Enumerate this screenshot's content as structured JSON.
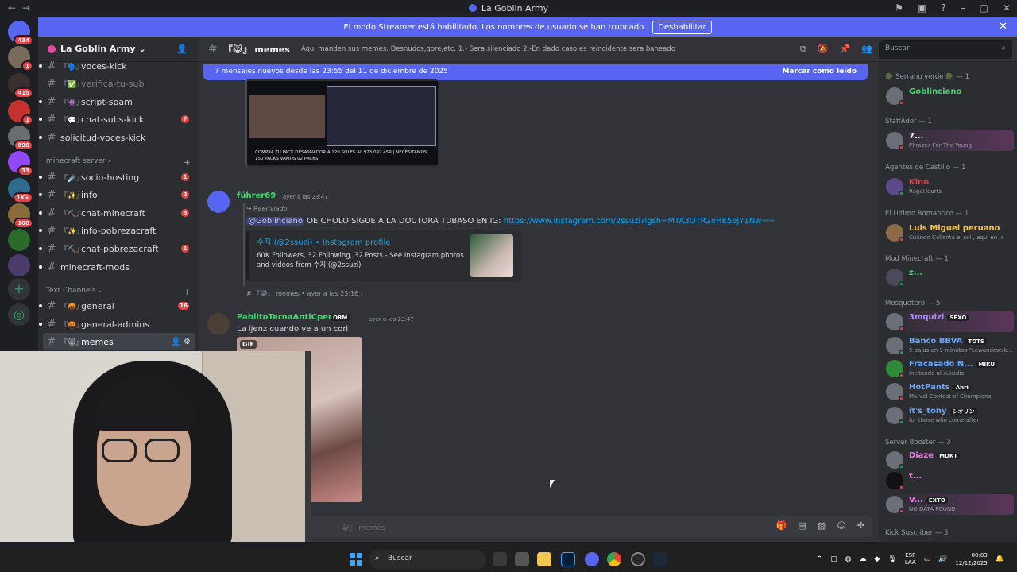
{
  "window": {
    "title": "La Goblin Army"
  },
  "banner": {
    "text": "El modo Streamer está habilitado. Los nombres de usuario se han truncado.",
    "button": "Deshabilitar"
  },
  "servers": {
    "badges": [
      "434",
      "1",
      "415",
      "1",
      "898",
      "33",
      "1K+",
      "100"
    ]
  },
  "sidebar": {
    "guild_name": "La Goblin Army",
    "channels_top": [
      {
        "emoji": "『🗣️』",
        "label": "voces-kick",
        "muted": false,
        "count": ""
      },
      {
        "emoji": "『✅』",
        "label": "verifica-tu-sub",
        "muted": true,
        "count": ""
      },
      {
        "emoji": "『👾』",
        "label": "script-spam",
        "muted": false,
        "count": ""
      },
      {
        "emoji": "『💬』",
        "label": "chat-subs-kick",
        "muted": false,
        "count": "7"
      },
      {
        "emoji": "",
        "label": "solicitud-voces-kick",
        "muted": false,
        "count": ""
      }
    ],
    "category_minecraft": "minecraft server",
    "channels_minecraft": [
      {
        "emoji": "『☄️』",
        "label": "socio-hosting",
        "count": "1"
      },
      {
        "emoji": "『✨』",
        "label": "info",
        "count": "2"
      },
      {
        "emoji": "『⛏️』",
        "label": "chat-minecraft",
        "count": "3"
      },
      {
        "emoji": "『✨』",
        "label": "info-pobrezacraft",
        "count": ""
      },
      {
        "emoji": "『⛏️』",
        "label": "chat-pobrezacraft",
        "count": "1"
      },
      {
        "emoji": "",
        "label": "minecraft-mods",
        "count": ""
      }
    ],
    "category_text": "Text Channels",
    "channels_text": [
      {
        "emoji": "『🤬』",
        "label": "general",
        "count": "16"
      },
      {
        "emoji": "『🤬』",
        "label": "general-admins",
        "count": ""
      },
      {
        "emoji": "『😹』",
        "label": "memes",
        "count": ""
      }
    ]
  },
  "chat_header": {
    "channel": "『😹』 memes",
    "topic": "Aqui manden sus memes. Desnudos,gore,etc. 1.- Sera silenciado 2.-En dado caso es reincidente sera baneado"
  },
  "search": {
    "placeholder": "Buscar"
  },
  "new_messages": {
    "text": "7 mensajes nuevos desde las 23:55 del 11 de diciembre de 2025",
    "action": "Marcar como leído"
  },
  "messages": {
    "promo_text": "COMPRA TU PACK DESASNADOR A 120 SOLES AL 923 097 459 | NECESITAMOS 150 PACKS VAMOS 02 PACKS",
    "m1": {
      "author": "führer69",
      "time": "ayer a las 23:47",
      "forwarded": "Reenviado",
      "mention": "@Goblinciano",
      "text": "OE CHOLO SIGUE A LA DOCTORA TUBASO EN IG:",
      "link": "https://www.instagram.com/2ssuzi?igsh=MTA3OTR2eHE5ejY1Nw==",
      "embed_title": "수지 (@2ssuzi) • Instagram profile",
      "embed_desc": "60K Followers, 32 Following, 32 Posts - See Instagram photos and videos from 수지 (@2ssuzi)",
      "source": "『😹』 memes • ayer a las 23:16"
    },
    "m2": {
      "author": "PablitoTernaAntiCperos",
      "tag": "ORM",
      "time": "ayer a las 23:47",
      "text": "La ijenz cuando ve a un cori",
      "gif_label": "GIF"
    }
  },
  "composer": {
    "placeholder": "『😹』 memes"
  },
  "members": [
    {
      "role": "🪖 Serrano verde 🪖 — 1"
    },
    {
      "name": "Goblinciano",
      "sub": "",
      "color": "#3ed96b"
    },
    {
      "role": "StaffAdor — 1"
    },
    {
      "name": "7...",
      "sub": "Phrazes For The Young",
      "color": "#ffffff"
    },
    {
      "role": "Agentes de Castillo — 1"
    },
    {
      "name": "Kino",
      "sub": "RageHearts",
      "color": "#e23c3c"
    },
    {
      "role": "El Ultimo Romantico — 1"
    },
    {
      "name": "Luis Miguel peruano",
      "sub": "Cuando Calienta el sol , aqui en la",
      "color": "#f5c542"
    },
    {
      "role": "Mod Minecraft — 1"
    },
    {
      "name": "z...",
      "sub": "",
      "color": "#3ed96b"
    },
    {
      "role": "Mosquetero — 5"
    },
    {
      "name": "3mquizi",
      "tag": "SEXO",
      "sub": "",
      "color": "#b38cff"
    },
    {
      "name": "Banco BBVA",
      "tag": "TOTS",
      "sub": "5 pajas en 9 minutos \"Lewandowsk...",
      "color": "#6aa7ff"
    },
    {
      "name": "Fracasado N...",
      "tag": "MIKU",
      "sub": "incitando al suicidio",
      "color": "#6aa7ff"
    },
    {
      "name": "HotPants",
      "tag": "Ahri",
      "sub": "Marvel Contest of Champions",
      "color": "#6aa7ff"
    },
    {
      "name": "it's_tony",
      "tag": "シオリン",
      "sub": "for those who come after",
      "color": "#6aa7ff"
    },
    {
      "role": "Server Booster — 3"
    },
    {
      "name": "Diaze",
      "tag": "MDKT",
      "sub": "",
      "color": "#ff73fa"
    },
    {
      "name": "t...",
      "sub": "",
      "color": "#ff73fa"
    },
    {
      "name": "V...",
      "tag": "EXTO",
      "sub": "NO DATA FOUND",
      "color": "#ff73fa"
    },
    {
      "role": "Kick Suscriber — 5"
    }
  ],
  "taskbar": {
    "search": "Buscar",
    "lang": "ESP",
    "lang2": "LAA",
    "time": "00:03",
    "date": "12/12/2025"
  }
}
